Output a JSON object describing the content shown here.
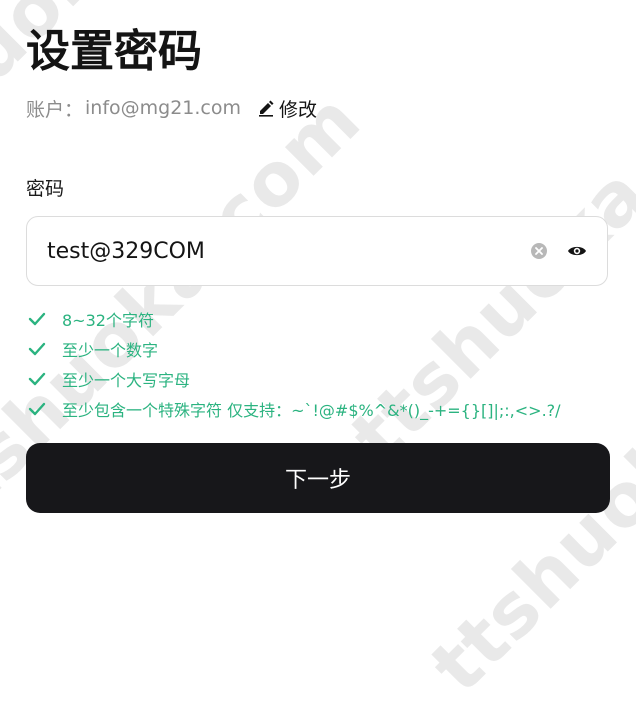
{
  "page": {
    "title": "设置密码"
  },
  "account": {
    "prefix": "账户：",
    "email": "info@mg21.com",
    "edit_label": "修改"
  },
  "password": {
    "label": "密码",
    "value": "test@329COM"
  },
  "rules": [
    {
      "text": "8~32个字符"
    },
    {
      "text": "至少一个数字"
    },
    {
      "text": "至少一个大写字母"
    },
    {
      "text": "至少包含一个特殊字符 仅支持：~`!@#$%^&*()_-+={}[]|;:,<>.?/"
    }
  ],
  "actions": {
    "next_label": "下一步"
  },
  "watermark": {
    "text": "ttshuoka.com"
  },
  "colors": {
    "accent_green": "#2bb380",
    "button_dark": "#17171a"
  }
}
